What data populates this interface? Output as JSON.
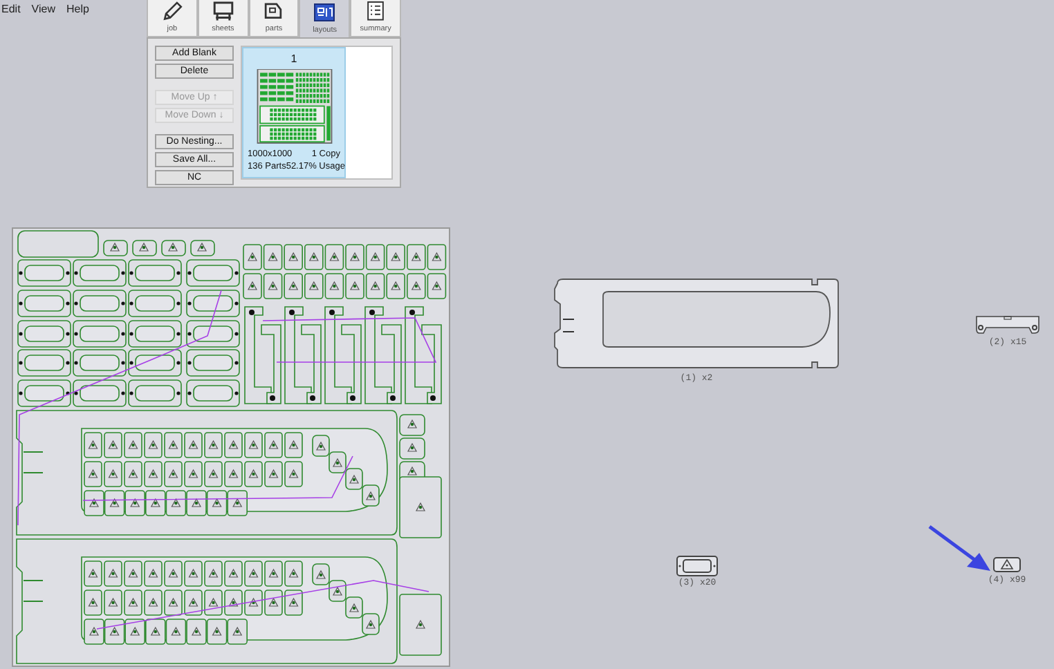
{
  "menu": [
    "Edit",
    "View",
    "Help"
  ],
  "tabs": [
    {
      "label": "job",
      "kind": "pencil",
      "selected": false
    },
    {
      "label": "sheets",
      "kind": "sheet",
      "selected": false
    },
    {
      "label": "parts",
      "kind": "part",
      "selected": false
    },
    {
      "label": "layouts",
      "kind": "layout",
      "selected": true
    },
    {
      "label": "summary",
      "kind": "list",
      "selected": false
    }
  ],
  "button_groups": [
    [
      {
        "label": "Add Blank",
        "disabled": false
      },
      {
        "label": "Delete",
        "disabled": false
      }
    ],
    [
      {
        "label": "Move Up ↑",
        "disabled": true
      },
      {
        "label": "Move Down ↓",
        "disabled": true
      }
    ],
    [
      {
        "label": "Do Nesting...",
        "disabled": false
      },
      {
        "label": "Save All...",
        "disabled": false
      },
      {
        "label": "NC",
        "disabled": false
      }
    ]
  ],
  "layouts": [
    {
      "number": "1",
      "size": "1000x1000",
      "copies": "1 Copy",
      "parts": "136 Parts",
      "usage": "52.17% Usage",
      "selected": true
    }
  ],
  "parts": [
    {
      "label": "(2)  x15",
      "kind": "bracket"
    },
    {
      "label": "(1)  x2",
      "kind": "frame"
    },
    {
      "label": "(3)  x20",
      "kind": "plate"
    },
    {
      "label": "(4)  x99",
      "kind": "triangle"
    }
  ]
}
